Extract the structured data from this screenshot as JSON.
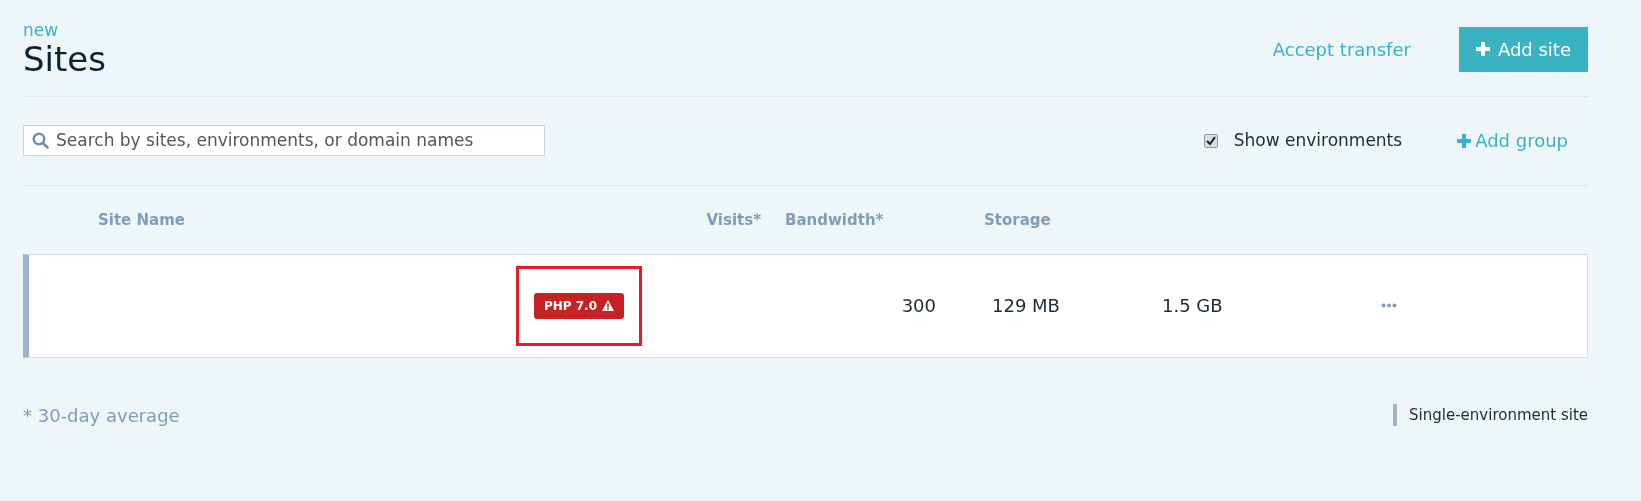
{
  "header": {
    "eyebrow": "new",
    "title": "Sites",
    "accept_link": "Accept transfer",
    "add_button": "Add site"
  },
  "toolbar": {
    "search": {
      "placeholder": "Search by sites, environments, or domain names"
    },
    "show_environments": {
      "label": "Show environments",
      "checked": true
    },
    "add_group": "Add group"
  },
  "table": {
    "columns": [
      "Site Name",
      "Visits*",
      "Bandwidth*",
      "Storage"
    ],
    "rows": [
      {
        "badge": "PHP 7.0",
        "badge_warning": true,
        "highlighted": true,
        "visits": "300",
        "bandwidth": "129 MB",
        "storage": "1.5 GB"
      }
    ]
  },
  "footer": {
    "note": "* 30-day average",
    "legend": "Single-environment site"
  }
}
